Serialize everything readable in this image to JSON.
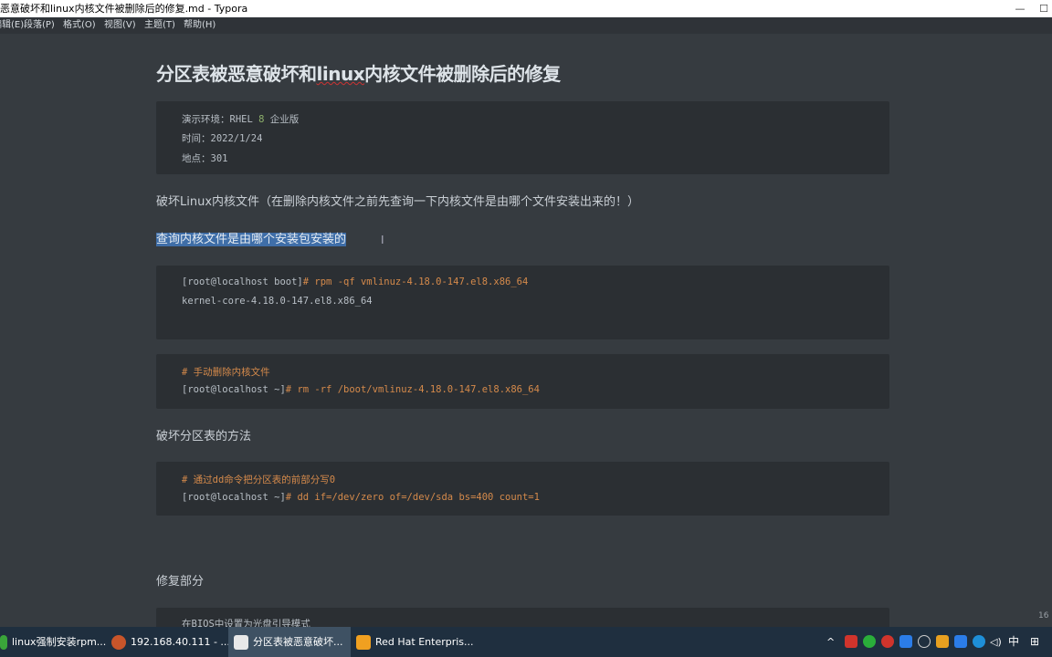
{
  "window": {
    "title": "恶意破坏和linux内核文件被删除后的修复.md - Typora",
    "minimize": "—",
    "maximize": "☐"
  },
  "menu": [
    "编辑(E)",
    "段落(P)",
    "格式(O)",
    "视图(V)",
    "主题(T)",
    "帮助(H)"
  ],
  "doc": {
    "heading_pre": "分区表被恶意破坏和",
    "heading_word": "linux",
    "heading_post": "内核文件被删除后的修复",
    "info": {
      "env_label": "演示环境：",
      "env_value": "RHEL ",
      "env_num": "8",
      "env_suffix": " 企业版",
      "time": "时间：2022/1/24",
      "place": "地点：301"
    },
    "para1": "破坏Linux内核文件（在删除内核文件之前先查询一下内核文件是由哪个文件安装出来的！）",
    "para2_selected": "查询内核文件是由哪个安装包安装的",
    "code1": {
      "prompt": "[root@localhost boot]",
      "cmd": "# rpm -qf vmlinuz-4.18.0-147.el8.x86_64",
      "out": "kernel-core-4.18.0-147.el8.x86_64"
    },
    "code2": {
      "comment": "# 手动删除内核文件",
      "prompt": "[root@localhost ~]",
      "cmd": "# rm -rf /boot/vmlinuz-4.18.0-147.el8.x86_64"
    },
    "para3": "破坏分区表的方法",
    "code3": {
      "comment": "# 通过dd命令把分区表的前部分写0",
      "prompt": "[root@localhost ~]",
      "cmd": "# dd if=/dev/zero of=/dev/sda bs=400 count=1"
    },
    "para4": "修复部分",
    "code4_partial": "在BIOS中设置为光盘引导模式",
    "side_number": "16"
  },
  "taskbar": {
    "items": [
      {
        "label": "linux强制安装rpm...",
        "active": false
      },
      {
        "label": "192.168.40.111 - ...",
        "active": false
      },
      {
        "label": "分区表被恶意破坏...",
        "active": true
      },
      {
        "label": "Red Hat Enterpris...",
        "active": false
      }
    ],
    "ime": "中",
    "grid": "⊞"
  },
  "colors": {
    "background": "#363b40",
    "code_bg": "#2b2f33",
    "accent_orange": "#d58a4b",
    "selection": "#3f6ea8",
    "taskbar": "#1f2f3f"
  }
}
